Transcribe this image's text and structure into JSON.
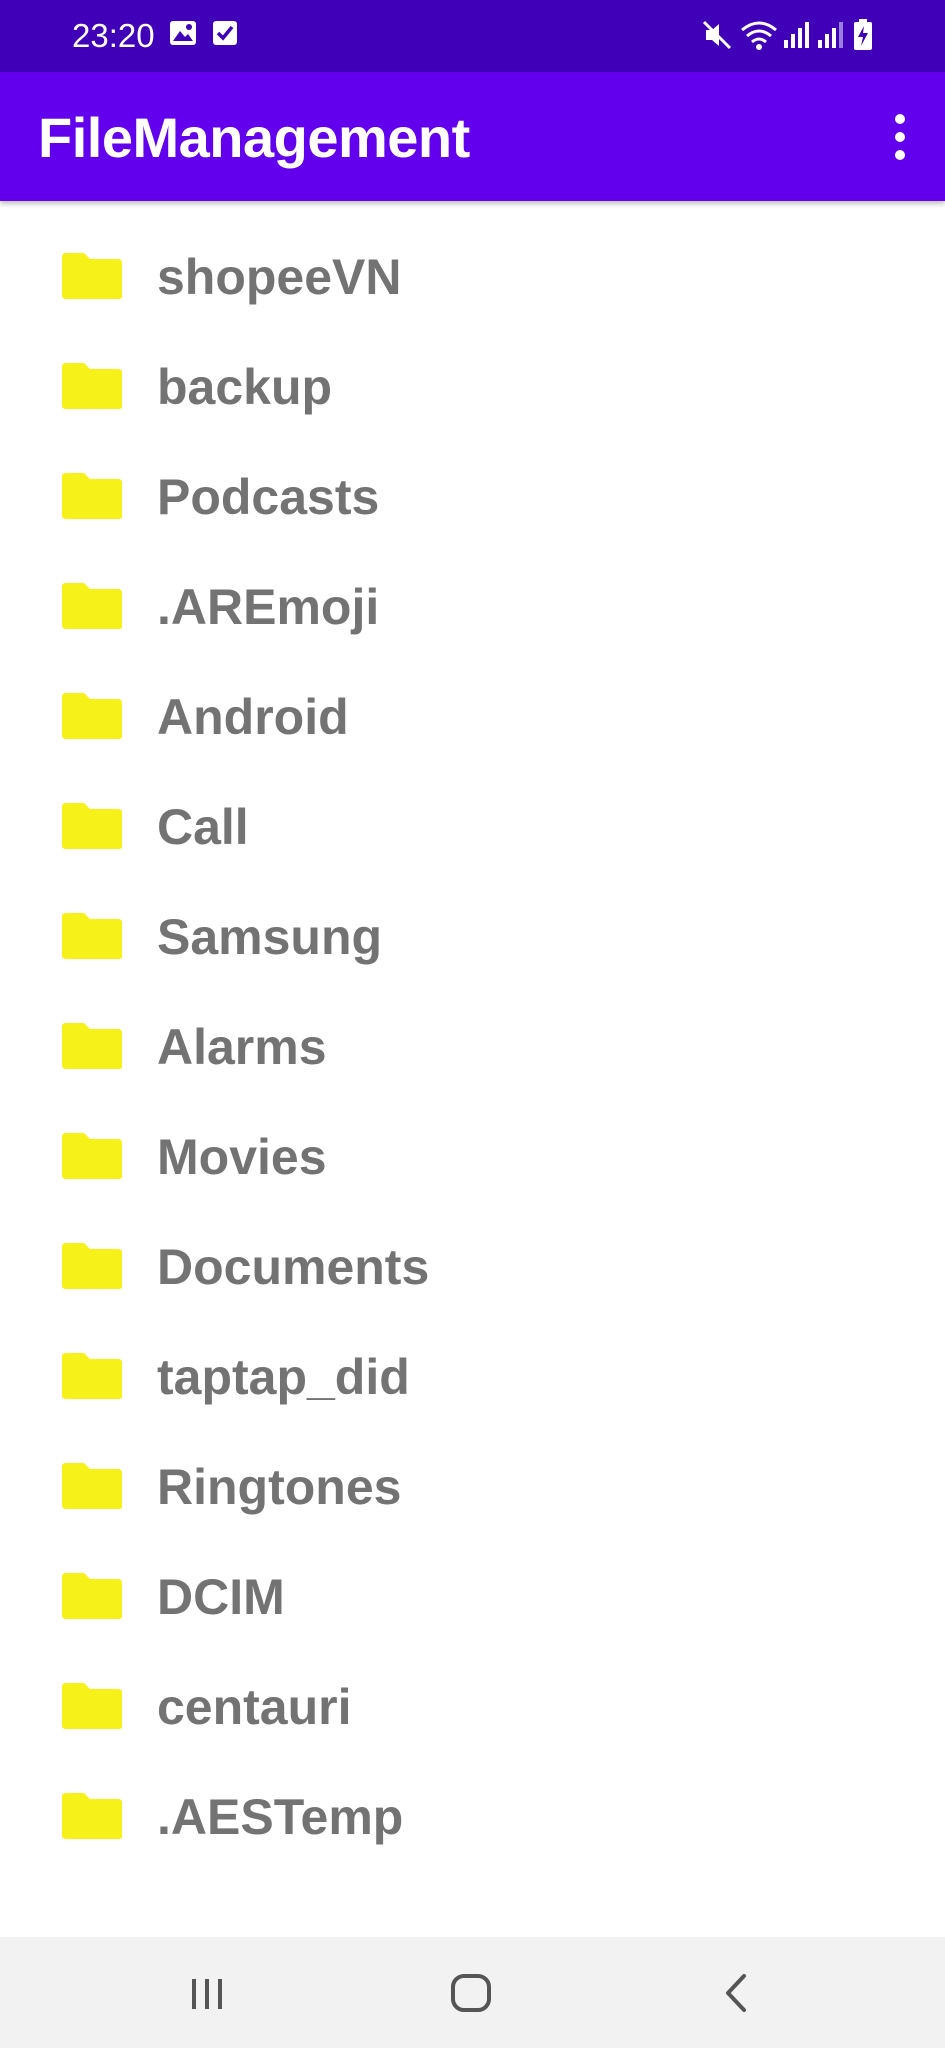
{
  "status_bar": {
    "time": "23:20",
    "left_icons": [
      "image-icon",
      "checkbox-icon"
    ],
    "right_icons": [
      "mute-icon",
      "wifi-icon",
      "signal-icon",
      "signal-icon",
      "battery-charging-icon"
    ]
  },
  "app_bar": {
    "title": "FileManagement",
    "menu_icon": "more-vert-icon"
  },
  "folder_list": {
    "icon": "folder-icon",
    "folder_color": "#f7f11a",
    "items": [
      {
        "name": "shopeeVN"
      },
      {
        "name": "backup"
      },
      {
        "name": "Podcasts"
      },
      {
        "name": ".AREmoji"
      },
      {
        "name": "Android"
      },
      {
        "name": "Call"
      },
      {
        "name": "Samsung"
      },
      {
        "name": "Alarms"
      },
      {
        "name": "Movies"
      },
      {
        "name": "Documents"
      },
      {
        "name": "taptap_did"
      },
      {
        "name": "Ringtones"
      },
      {
        "name": "DCIM"
      },
      {
        "name": "centauri"
      },
      {
        "name": ".AESTemp"
      }
    ]
  },
  "nav_bar": {
    "buttons": [
      "recents-icon",
      "home-icon",
      "back-icon"
    ]
  },
  "colors": {
    "status_bar": "#3f00b8",
    "app_bar": "#6200ee",
    "folder": "#f7f11a",
    "folder_text": "#737373",
    "nav_bar": "#f2f2f2"
  }
}
